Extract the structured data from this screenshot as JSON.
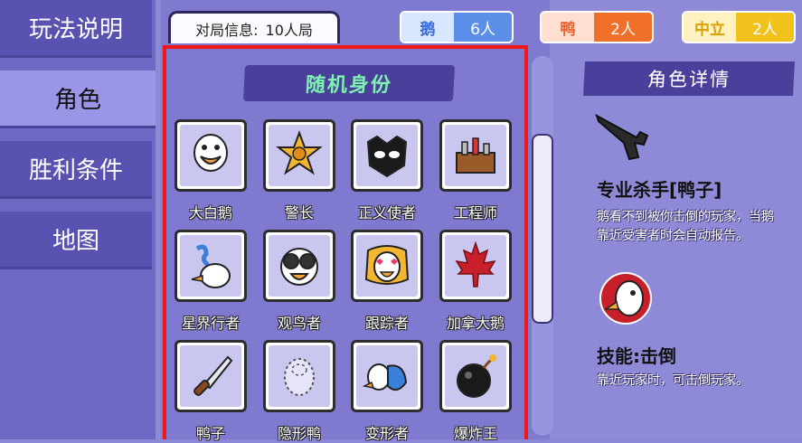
{
  "sidebar": {
    "items": [
      {
        "label": "玩法说明"
      },
      {
        "label": "角色"
      },
      {
        "label": "胜利条件"
      },
      {
        "label": "地图"
      }
    ]
  },
  "header": {
    "match_info_label": "对局信息:",
    "match_info_value": "10人局",
    "teams": [
      {
        "tag": "鹅",
        "count": "6人"
      },
      {
        "tag": "鸭",
        "count": "2人"
      },
      {
        "tag": "中立",
        "count": "2人"
      }
    ]
  },
  "roles_panel": {
    "banner": "随机身份",
    "roles": [
      {
        "label": "大白鹅"
      },
      {
        "label": "警长"
      },
      {
        "label": "正义使者"
      },
      {
        "label": "工程师"
      },
      {
        "label": "星界行者"
      },
      {
        "label": "观鸟者"
      },
      {
        "label": "跟踪者"
      },
      {
        "label": "加拿大鹅"
      },
      {
        "label": "鸭子"
      },
      {
        "label": "隐形鸭"
      },
      {
        "label": "变形者"
      },
      {
        "label": "爆炸王"
      }
    ]
  },
  "detail": {
    "title": "角色详情",
    "role_name": "专业杀手[鸭子]",
    "role_desc": "鹅看不到被你击倒的玩家，当鹅靠近受害者时会自动报告。",
    "skill_title": "技能:击倒",
    "skill_desc": "靠近玩家时，可击倒玩家。"
  },
  "colors": {
    "goose": "#5b8fe8",
    "duck": "#f0702a",
    "neutral": "#f2c21c",
    "accent": "#4a3f9a",
    "highlight": "#f01818"
  }
}
